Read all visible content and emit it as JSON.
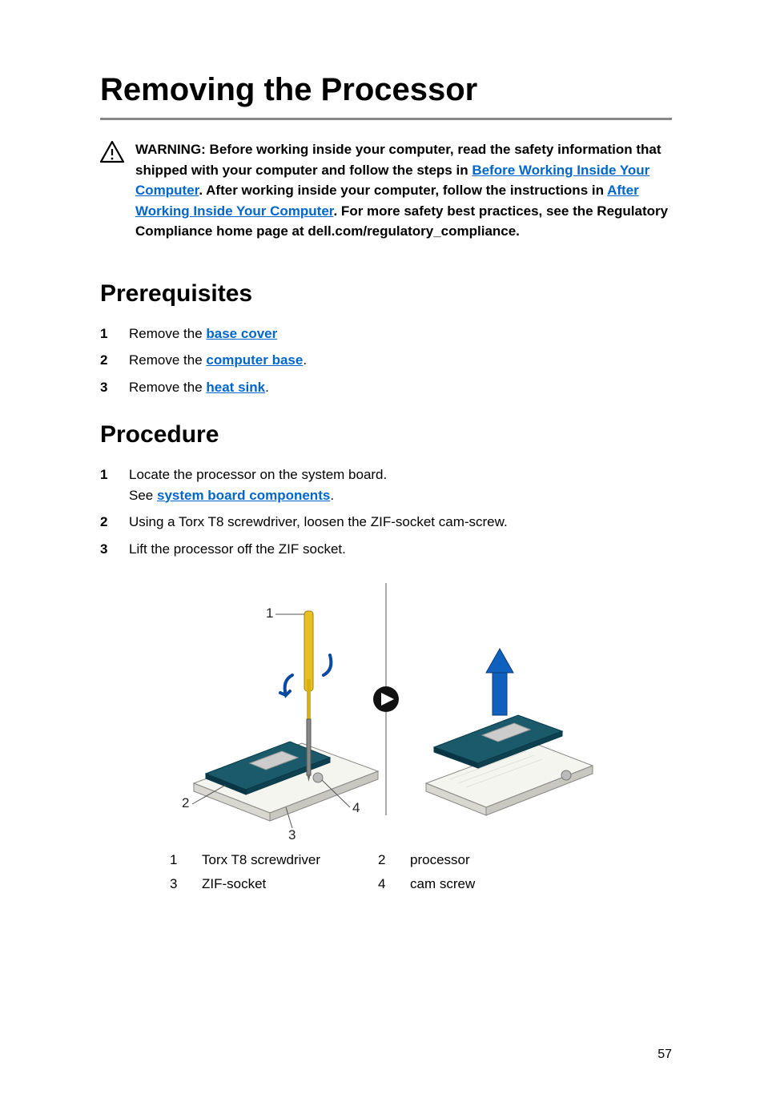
{
  "title": "Removing the Processor",
  "warning": {
    "prefix": "WARNING: Before working inside your computer, read the safety information that shipped with your computer and follow the steps in ",
    "link1": "Before Working Inside Your Computer",
    "mid1": ". After working inside your computer, follow the instructions in ",
    "link2": "After Working Inside Your Computer",
    "mid2": ". For more safety best practices, see the Regulatory Compliance home page at dell.com/regulatory_compliance."
  },
  "prerequisites": {
    "heading": "Prerequisites",
    "items": [
      {
        "num": "1",
        "prefix": "Remove the ",
        "link": "base cover"
      },
      {
        "num": "2",
        "prefix": "Remove the ",
        "link": "computer base",
        "suffix": "."
      },
      {
        "num": "3",
        "prefix": "Remove the ",
        "link": "heat sink",
        "suffix": "."
      }
    ]
  },
  "procedure": {
    "heading": "Procedure",
    "items": [
      {
        "num": "1",
        "line1": "Locate the processor on the system board.",
        "line2_prefix": "See ",
        "line2_link": "system board components",
        "line2_suffix": "."
      },
      {
        "num": "2",
        "text": "Using a Torx T8 screwdriver, loosen the ZIF-socket cam-screw."
      },
      {
        "num": "3",
        "text": "Lift the processor off the ZIF socket."
      }
    ]
  },
  "callouts": {
    "c1": "1",
    "c2": "2",
    "c3": "3",
    "c4": "4"
  },
  "legend": {
    "row1": {
      "n1": "1",
      "l1": "Torx T8 screwdriver",
      "n2": "2",
      "l2": "processor"
    },
    "row2": {
      "n1": "3",
      "l1": "ZIF-socket",
      "n2": "4",
      "l2": "cam screw"
    }
  },
  "page_number": "57"
}
